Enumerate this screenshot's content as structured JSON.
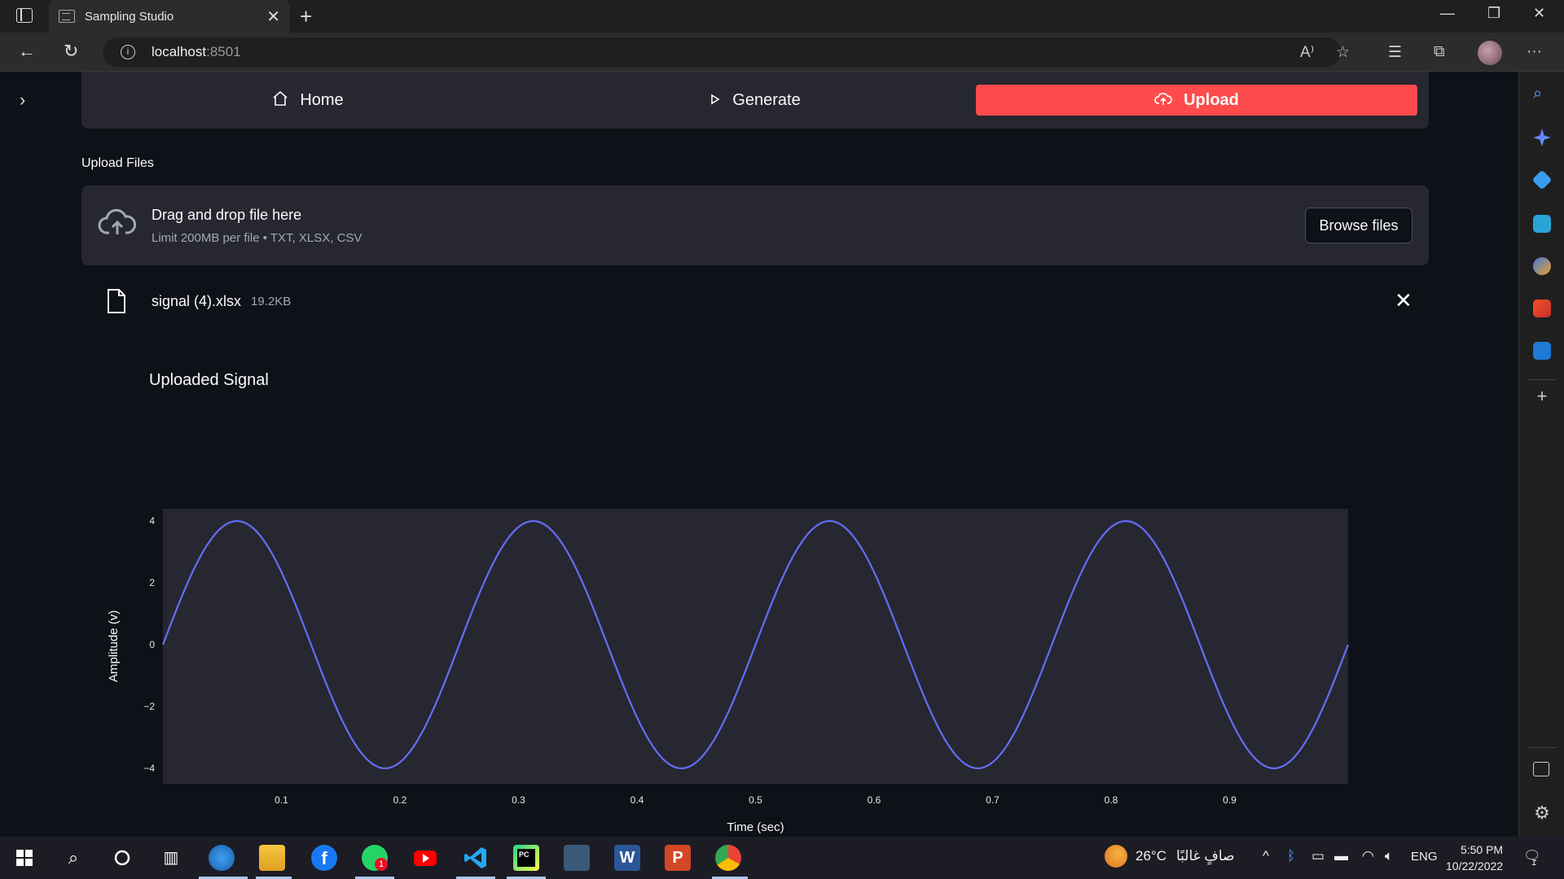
{
  "browser": {
    "tab_title": "Sampling Studio",
    "url_host": "localhost",
    "url_port": ":8501"
  },
  "nav": {
    "items": [
      {
        "label": "Home",
        "icon": "home-icon"
      },
      {
        "label": "Generate",
        "icon": "play-icon"
      },
      {
        "label": "Upload",
        "icon": "cloud-upload-icon",
        "active": true
      }
    ]
  },
  "uploader": {
    "label": "Upload Files",
    "drop_title": "Drag and drop file here",
    "limit_text": "Limit 200MB per file • TXT, XLSX, CSV",
    "browse_label": "Browse files"
  },
  "file": {
    "name": "signal (4).xlsx",
    "size": "19.2KB"
  },
  "colors": {
    "accent": "#ff4b4b",
    "line": "#636efa",
    "plot_bg": "#262730",
    "page_bg": "#0e1117"
  },
  "chart_data": {
    "type": "line",
    "title": "Uploaded Signal",
    "xlabel": "Time (sec)",
    "ylabel": "Amplitude (v)",
    "xlim": [
      0.0,
      1.0
    ],
    "ylim": [
      -4.5,
      4.4
    ],
    "xticks": [
      0.1,
      0.2,
      0.3,
      0.4,
      0.5,
      0.6,
      0.7,
      0.8,
      0.9
    ],
    "xtick_labels": [
      "0.1",
      "0.2",
      "0.3",
      "0.4",
      "0.5",
      "0.6",
      "0.7",
      "0.8",
      "0.9"
    ],
    "yticks": [
      -4,
      -2,
      0,
      2,
      4
    ],
    "ytick_labels": [
      "−4",
      "−2",
      "0",
      "2",
      "4"
    ],
    "grid": false,
    "series": [
      {
        "x": [
          0.0,
          0.0625,
          0.125,
          0.1875,
          0.25,
          0.3125,
          0.375,
          0.4375,
          0.5,
          0.5625,
          0.625,
          0.6875,
          0.75,
          0.8125,
          0.875,
          0.9375,
          1.0
        ],
        "values": [
          0,
          4,
          0,
          -4,
          0,
          4,
          0,
          -4,
          0,
          4,
          0,
          -4,
          0,
          4,
          0,
          -4,
          0
        ],
        "shape": "sine",
        "amplitude": 4,
        "frequency_hz": 4
      }
    ]
  },
  "taskbar": {
    "weather": "26°C",
    "weather_text": "صافٍ غالبًا",
    "lang": "ENG",
    "time": "5:50 PM",
    "date": "10/22/2022",
    "whatsapp_badge": "1",
    "notif_badge": "1"
  }
}
